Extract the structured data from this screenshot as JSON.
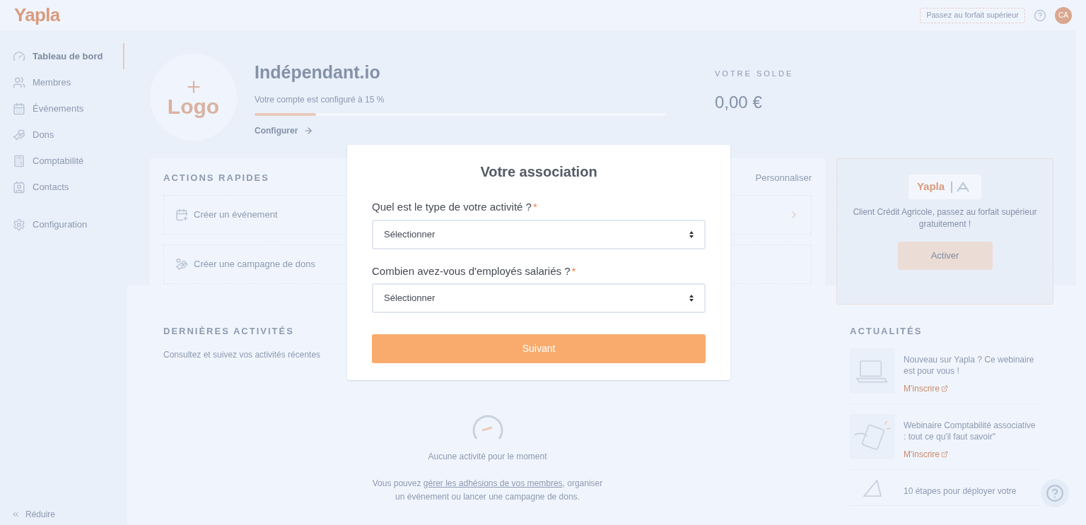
{
  "topbar": {
    "logo": "Yapla",
    "upgrade_button": "Passez au forfait supérieur",
    "avatar": "CA"
  },
  "sidebar": {
    "items": [
      {
        "label": "Tableau de bord",
        "selected": true
      },
      {
        "label": "Membres",
        "selected": false
      },
      {
        "label": "Événements",
        "selected": false
      },
      {
        "label": "Dons",
        "selected": false
      },
      {
        "label": "Comptabilité",
        "selected": false
      },
      {
        "label": "Contacts",
        "selected": false
      }
    ],
    "settings_item": {
      "label": "Configuration",
      "selected": false
    },
    "collapse": "Réduire"
  },
  "hero": {
    "logo_label": "Logo",
    "name": "Indépendant.io",
    "progress_text": "Votre compte est configuré à 15 %",
    "level": 0.15,
    "configure_link": "Configurer",
    "balance_label": "VOTRE SOLDE",
    "balance": "0,00 €"
  },
  "quick_actions": {
    "title": "ACTIONS RAPIDES",
    "customize": "Personnaliser",
    "items": [
      "Créer un événement",
      "Créer une campagne de dons"
    ]
  },
  "promo": {
    "logo": "Yapla",
    "text": "Client Crédit Agricole, passez au forfait supérieur gratuitement !",
    "button": "Activer"
  },
  "activities": {
    "title": "DERNIÈRES ACTIVITÉS",
    "subtitle": "Consultez et suivez vos activités récentes",
    "empty": "Aucune activité pour le moment",
    "hint_before": "Vous pouvez ",
    "hint_link": "gérer les adhésions de vos membres",
    "hint_after": ", organiser un événement ou lancer une campagne de dons."
  },
  "news": {
    "title": "ACTUALITÉS",
    "items": [
      {
        "title": "Nouveau sur Yapla ? Ce webinaire est pour vous !",
        "link": "M'inscrire"
      },
      {
        "title": "Webinaire Comptabilité associative : tout ce qu'il faut savoir\"",
        "link": "M'inscrire"
      },
      {
        "title": "10 étapes pour déployer votre"
      }
    ]
  },
  "modal": {
    "title": "Votre association",
    "required_mark": "*",
    "fields": [
      {
        "label": "Quel est le type de votre activité ?",
        "required": true,
        "value": "Sélectionner"
      },
      {
        "label": "Combien avez-vous d'employés salariés ?",
        "required": true,
        "value": "Sélectionner"
      }
    ],
    "submit": "Suivant"
  }
}
